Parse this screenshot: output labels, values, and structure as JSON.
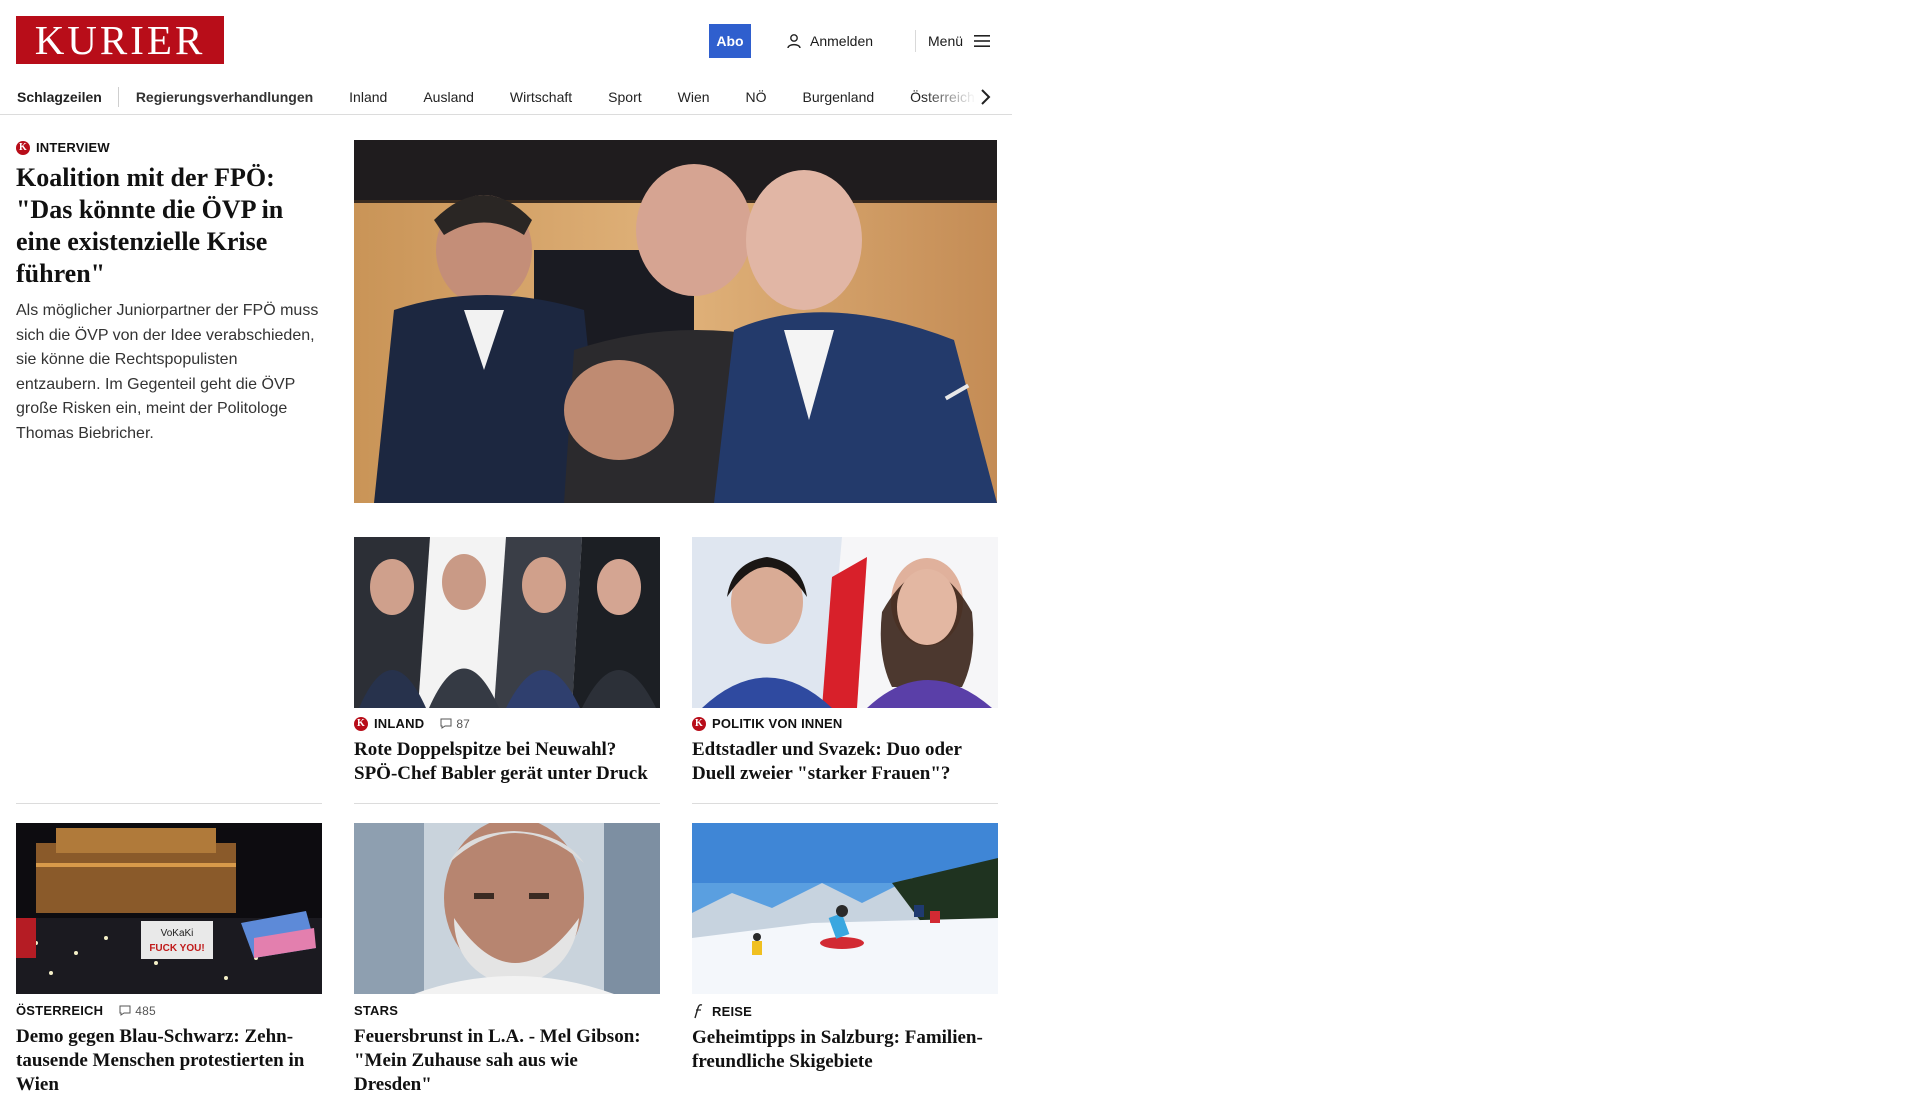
{
  "brand": {
    "logo_text": "KURIER",
    "accent": "#b80d19",
    "abo_color": "#2f5fce"
  },
  "header": {
    "abo_label": "Abo",
    "login_label": "Anmelden",
    "menu_label": "Menü"
  },
  "nav": {
    "items": [
      "Schlagzeilen",
      "Regierungsverhandlungen",
      "Inland",
      "Ausland",
      "Wirtschaft",
      "Sport",
      "Wien",
      "NÖ",
      "Burgenland",
      "Österreich"
    ]
  },
  "lead": {
    "kicker": "INTERVIEW",
    "title": "Koalition mit der FPÖ: \"Das könnte die ÖVP in eine existenzielle Krise führen\"",
    "teaser": "Als möglicher Juniorpartner der FPÖ muss sich die ÖVP von der Idee verabschieden, sie könne die Rechtspopulisten entzaubern. Im Gegenteil geht die ÖVP große Risken ein, meint der Politologe Thomas Biebricher."
  },
  "articles": [
    {
      "kicker": "INLAND",
      "comments": "87",
      "title": "Rote Doppelspitze bei Neuwahl? SPÖ-Chef Babler gerät unter Druck"
    },
    {
      "kicker": "POLITIK VON INNEN",
      "title": "Edtstadler und Svazek: Duo oder Duell zweier \"starker Frauen\"?"
    },
    {
      "kicker": "ÖSTERREICH",
      "comments": "485",
      "title": "Demo gegen Blau-Schwarz: Zehn­tausende Menschen protestierten in Wien",
      "sign_text_1": "VoKaKi",
      "sign_text_2": "FUCK YOU!"
    },
    {
      "kicker": "STARS",
      "title": "Feuersbrunst in L.A. - Mel Gibson: \"Mein Zuhause sah aus wie Dresden\""
    },
    {
      "kicker": "REISE",
      "title": "Geheimtipps in Salzburg: Familien­freundliche Skigebiete"
    }
  ],
  "icons": {
    "user": "user-icon",
    "menu": "hamburger-icon",
    "next": "chevron-right-icon",
    "comment": "comment-icon",
    "kurier_badge": "kurier-k-badge-icon",
    "reise": "freizeit-f-icon"
  }
}
